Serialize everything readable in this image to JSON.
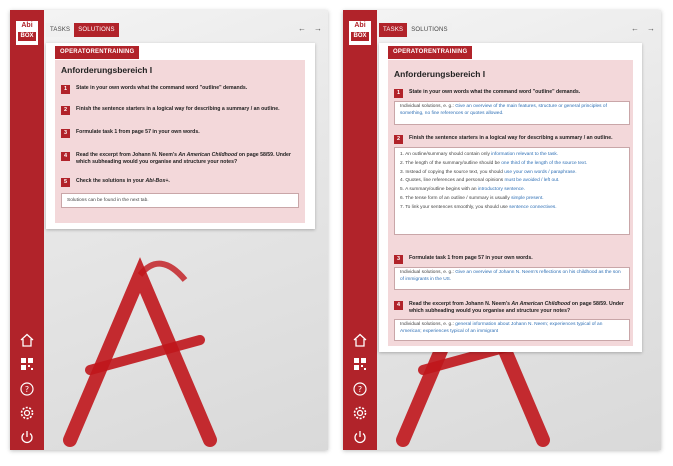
{
  "colors": {
    "brand": "#b1232a",
    "pink": "#f3d8da",
    "link": "#2e6fb5"
  },
  "logo": {
    "top": "Abi",
    "bottom": "BOX"
  },
  "sidebar_icons": [
    "home-icon",
    "qr-code-icon",
    "help-icon",
    "settings-icon",
    "power-icon"
  ],
  "nav": {
    "prev": "←",
    "next": "→"
  },
  "left": {
    "tabs": {
      "tasks": "TASKS",
      "solutions": "SOLUTIONS"
    },
    "header": "OPERATORENTRAINING",
    "title": "Anforderungsbereich I",
    "tasks": [
      {
        "num": "1",
        "text": "State in your own words what the command word \"outline\" demands."
      },
      {
        "num": "2",
        "text": "Finish the sentence starters in a logical way for describing a summary / an outline."
      },
      {
        "num": "3",
        "text": "Formulate task 1 from page 57 in your own words."
      },
      {
        "num": "4",
        "text_a": "Read the excerpt from Johann N. Neem's ",
        "text_it": "An American Childhood",
        "text_b": " on page 58/59. Under which subheading would you organise and structure your notes?"
      },
      {
        "num": "5",
        "text_a": "Check the solutions in your ",
        "text_it": "Abi-Box+",
        "text_b": "."
      }
    ],
    "note": "Solutions can be found in the next tab."
  },
  "right": {
    "tabs": {
      "tasks": "TASKS",
      "solutions": "SOLUTIONS"
    },
    "header": "OPERATORENTRAINING",
    "title": "Anforderungsbereich I",
    "task1": {
      "num": "1",
      "text": "State in your own words what the command word \"outline\" demands.",
      "sol_a": "Individual solutions, e. g.: ",
      "sol_b": "Give an overview of the main features, structure or general principles of something, no fine references or quotes allowed."
    },
    "task2": {
      "num": "2",
      "text": "Finish the sentence starters in a logical way for describing a summary / an outline.",
      "items": [
        {
          "a": "1. An outline/summary should contain only ",
          "b": "information relevant to the task."
        },
        {
          "a": "2. The length of the summary/outline should be ",
          "b": "one third of the length of the source text."
        },
        {
          "a": "3. Instead of copying the source text, you should ",
          "b": "use your own words / paraphrase."
        },
        {
          "a": "4. Quotes, line references and personal opinions ",
          "b": "must be avoided / left out."
        },
        {
          "a": "5. A summary/outline begins with an ",
          "b": "introductory sentence."
        },
        {
          "a": "6. The tense form of an outline / summary is usually ",
          "b": "simple present."
        },
        {
          "a": "7. To link your sentences smoothly, you should use ",
          "b": "sentence connectives."
        }
      ]
    },
    "task3": {
      "num": "3",
      "text": "Formulate task 1 from page 57 in your own words.",
      "sol_a": "Individual solutions, e. g.: ",
      "sol_b": "Give an overview of Johann N. Neem's reflections on his childhood as the son of immigrants in the US."
    },
    "task4": {
      "num": "4",
      "text_a": "Read the excerpt from Johann N. Neem's ",
      "text_it": "An American Childhood",
      "text_b": " on page 58/59. Under which subheading would you organise and structure your notes?",
      "sol_a": "Individual solutions, e. g.: ",
      "sol_b": "general information about Johann N. Neem; experiences typical of an American; experiences typical of an immigrant"
    }
  }
}
